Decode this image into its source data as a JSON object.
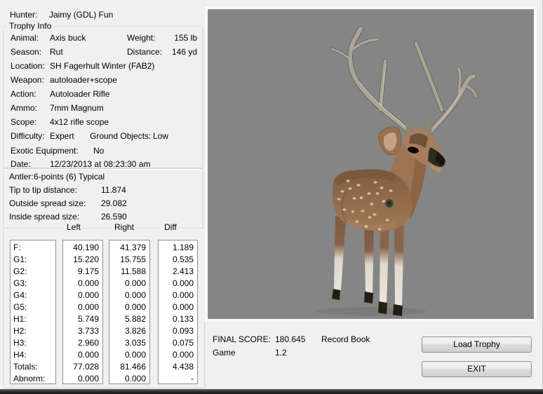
{
  "hunter": {
    "label": "Hunter:",
    "value": "Jaimy (GDL) Fun"
  },
  "trophy_info": {
    "title": "Trophy Info",
    "animal": {
      "label": "Animal:",
      "value": "Axis buck"
    },
    "weight": {
      "label": "Weight:",
      "value": "155 lb"
    },
    "season": {
      "label": "Season:",
      "value": "Rut"
    },
    "distance": {
      "label": "Distance:",
      "value": "146 yd"
    },
    "location": {
      "label": "Location:",
      "value": "SH Fagerhult Winter (FAB2)"
    },
    "weapon": {
      "label": "Weapon:",
      "value": "autoloader+scope"
    },
    "action": {
      "label": "Action:",
      "value": "Autoloader Rifle"
    },
    "ammo": {
      "label": "Ammo:",
      "value": "7mm Magnum"
    },
    "scope": {
      "label": "Scope:",
      "value": "4x12 rifle scope"
    },
    "difficulty": {
      "label": "Difficulty:",
      "value": "Expert"
    },
    "ground_objects": {
      "label": "Ground Objects:",
      "value": "Low"
    },
    "exotic_equipment": {
      "label": "Exotic Equipment:",
      "value": "No"
    },
    "date": {
      "label": "Date:",
      "value": "12/23/2013 at 08:23:30 am"
    }
  },
  "antler_info": {
    "antler": {
      "label": "Antler:",
      "value": "6-points (6) Typical"
    },
    "tip_to_tip": {
      "label": "Tip to tip distance:",
      "value": "11.874"
    },
    "outside_spread": {
      "label": "Outside spread size:",
      "value": "29.082"
    },
    "inside_spread": {
      "label": "Inside spread size:",
      "value": "26.590"
    }
  },
  "measurements": {
    "headers": [
      "Left",
      "Right",
      "Diff"
    ],
    "row_labels": [
      "F:",
      "G1:",
      "G2:",
      "G3:",
      "G4:",
      "G5:",
      "H1:",
      "H2:",
      "H3:",
      "H4:",
      "Totals:",
      "Abnorm:"
    ],
    "left": [
      "40.190",
      "15.220",
      "9.175",
      "0.000",
      "0.000",
      "0.000",
      "5.749",
      "3.733",
      "2.960",
      "0.000",
      "77.028",
      "0.000"
    ],
    "right": [
      "41.379",
      "15.755",
      "11.588",
      "0.000",
      "0.000",
      "0.000",
      "5.882",
      "3.826",
      "3.035",
      "0.000",
      "81.466",
      "0.000"
    ],
    "diff": [
      "1.189",
      "0.535",
      "2.413",
      "0.000",
      "0.000",
      "0.000",
      "0.133",
      "0.093",
      "0.075",
      "0.000",
      "4.438",
      "-"
    ]
  },
  "score": {
    "final_label": "FINAL SCORE:",
    "final_value": "180.645",
    "record": "Record Book",
    "game_label": "Game",
    "game_value": "1.2"
  },
  "buttons": {
    "load_trophy": "Load Trophy",
    "exit": "EXIT"
  },
  "colors": {
    "window_bg": "#f0f0f0",
    "viewer_bg": "#858585",
    "deer_body": "#916a4b",
    "deer_spots": "#d5c5a3",
    "antler": "#aaa496",
    "lower_leg": "#e6e2d7",
    "hoof": "#1c1611"
  }
}
